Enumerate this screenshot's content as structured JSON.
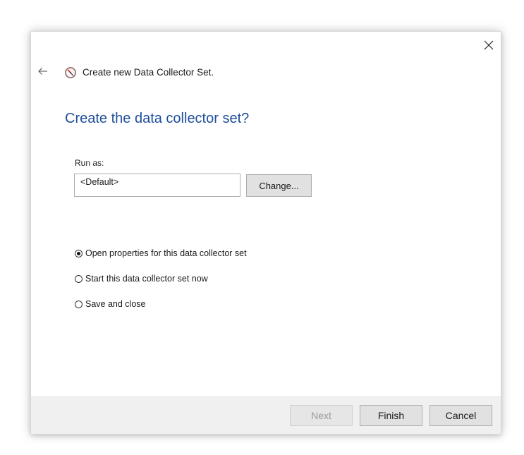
{
  "dialog": {
    "title": "Create new Data Collector Set.",
    "heading": "Create the data collector set?",
    "close_icon": "close-icon",
    "back_icon": "back-arrow-icon",
    "app_icon": "performance-monitor-icon"
  },
  "run_as": {
    "label": "Run as:",
    "value": "<Default>",
    "change_label": "Change..."
  },
  "options": [
    {
      "label": "Open properties for this data collector set",
      "checked": true
    },
    {
      "label": "Start this data collector set now",
      "checked": false
    },
    {
      "label": "Save and close",
      "checked": false
    }
  ],
  "footer": {
    "next_label": "Next",
    "next_enabled": false,
    "finish_label": "Finish",
    "cancel_label": "Cancel"
  },
  "colors": {
    "heading": "#1f4e99",
    "footer_bg": "#f0f0f0",
    "button_bg": "#e1e1e1"
  }
}
